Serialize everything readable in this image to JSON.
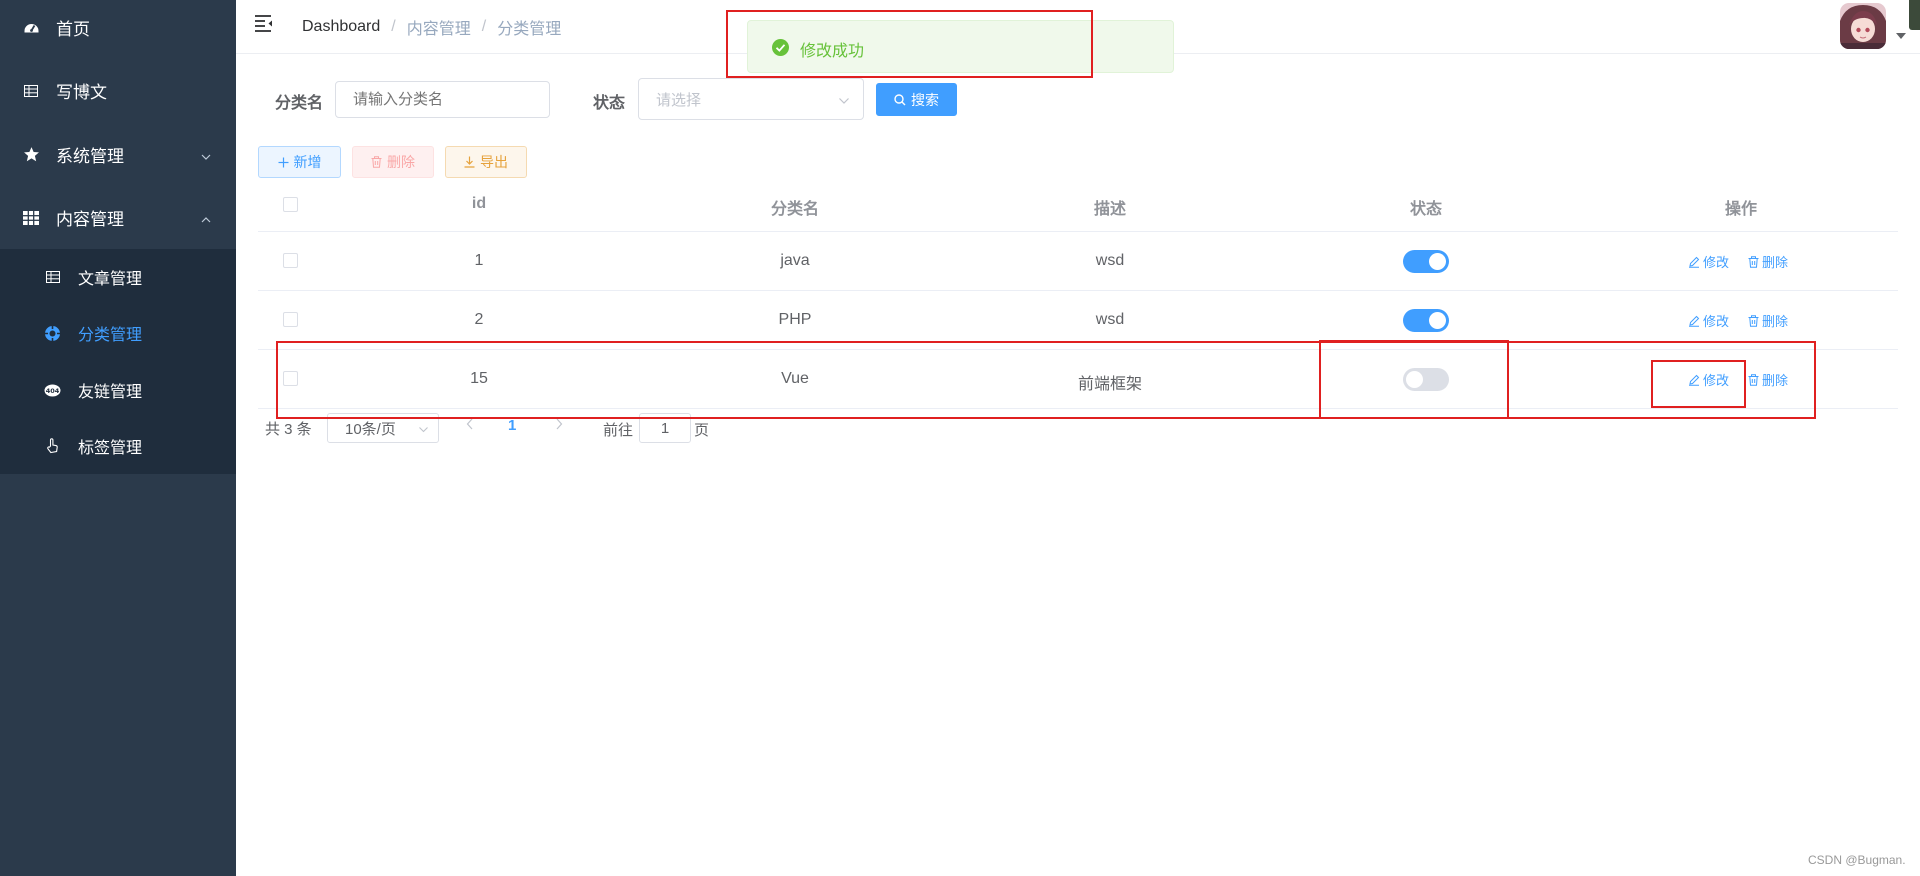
{
  "sidebar": {
    "items": [
      {
        "label": "首页",
        "icon": "dashboard-icon"
      },
      {
        "label": "写博文",
        "icon": "table-icon"
      },
      {
        "label": "系统管理",
        "icon": "star-icon"
      },
      {
        "label": "内容管理",
        "icon": "grid-icon"
      }
    ],
    "submenu": [
      {
        "label": "文章管理",
        "icon": "table-icon"
      },
      {
        "label": "分类管理",
        "icon": "category-icon",
        "active": true
      },
      {
        "label": "友链管理",
        "icon": "404-icon"
      },
      {
        "label": "标签管理",
        "icon": "hand-icon"
      }
    ]
  },
  "header": {
    "breadcrumb": [
      "Dashboard",
      "内容管理",
      "分类管理"
    ]
  },
  "toast": {
    "message": "修改成功",
    "type": "success"
  },
  "search": {
    "name_label": "分类名",
    "name_placeholder": "请输入分类名",
    "status_label": "状态",
    "status_placeholder": "请选择",
    "search_button": "搜索"
  },
  "toolbar": {
    "add": "新增",
    "delete": "删除",
    "export": "导出"
  },
  "table": {
    "headers": [
      "id",
      "分类名",
      "描述",
      "状态",
      "操作"
    ],
    "rows": [
      {
        "id": "1",
        "name": "java",
        "desc": "wsd",
        "status": true
      },
      {
        "id": "2",
        "name": "PHP",
        "desc": "wsd",
        "status": true
      },
      {
        "id": "15",
        "name": "Vue",
        "desc": "前端框架",
        "status": false
      }
    ],
    "edit": "修改",
    "remove": "删除"
  },
  "pagination": {
    "total": "共 3 条",
    "page_size": "10条/页",
    "current": "1",
    "goto": "前往",
    "jump_value": "1",
    "page": "页"
  },
  "watermark": "CSDN @Bugman.",
  "colors": {
    "sidebar_bg": "#2b3a4b",
    "submenu_bg": "#1f2d3d",
    "primary": "#409eff",
    "success": "#67c23a",
    "danger": "#f56c6c",
    "warning": "#e6a23c",
    "highlight_box": "#e02020"
  }
}
